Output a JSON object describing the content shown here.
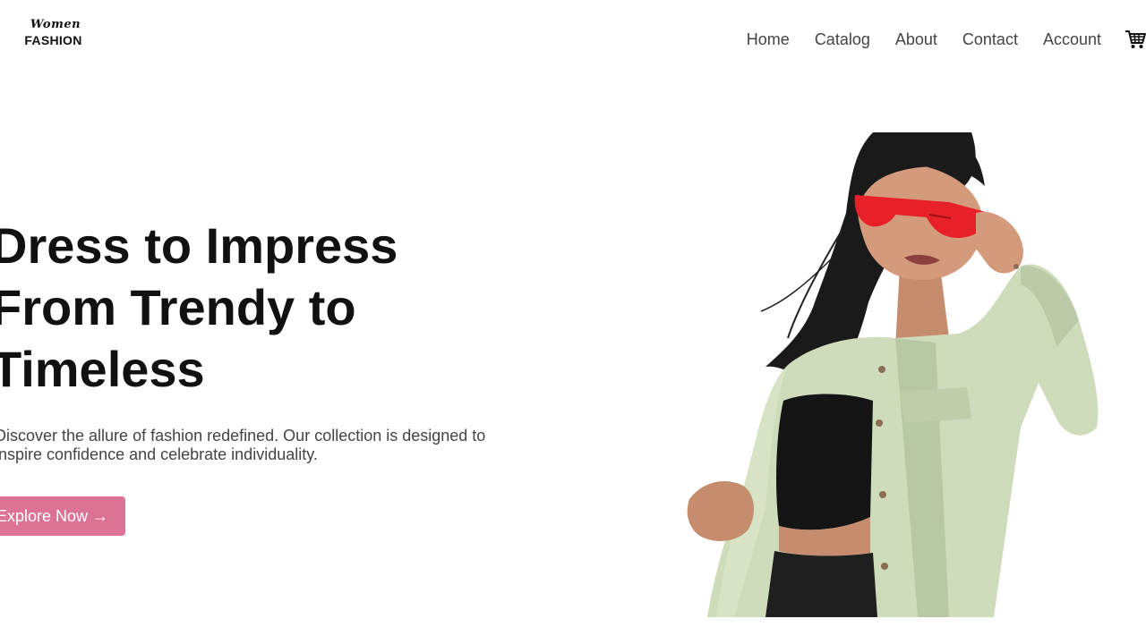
{
  "header": {
    "logo": {
      "script_text": "Women",
      "word_text": "FASHION"
    },
    "nav": [
      {
        "label": "Home"
      },
      {
        "label": "Catalog"
      },
      {
        "label": "About"
      },
      {
        "label": "Contact"
      },
      {
        "label": "Account"
      }
    ],
    "cart_icon": "shopping-cart-icon"
  },
  "hero": {
    "title_lines": [
      "Dress to Impress",
      "From Trendy to",
      "Timeless"
    ],
    "description_lines": [
      "Discover the allure of fashion redefined. Our collection is designed to",
      "inspire confidence and celebrate individuality."
    ],
    "cta_label": "Explore Now →",
    "image_subject": "woman-in-mint-jacket-with-red-sunglasses"
  },
  "colors": {
    "accent": "#dc7395",
    "text_dark": "#111111",
    "text_muted": "#444444",
    "jacket": "#cfdcbb",
    "sunglasses": "#e8202a"
  }
}
